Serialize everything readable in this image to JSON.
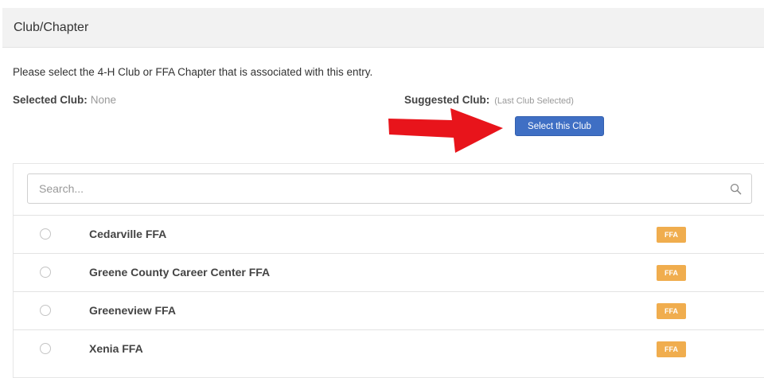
{
  "panel": {
    "title": "Club/Chapter"
  },
  "instructions": "Please select the 4-H Club or FFA Chapter that is associated with this entry.",
  "selected": {
    "label": "Selected Club:",
    "value": "None"
  },
  "suggested": {
    "label": "Suggested Club:",
    "value": "(Last Club Selected)"
  },
  "select_button": {
    "label": "Select this Club"
  },
  "search": {
    "placeholder": "Search...",
    "value": ""
  },
  "clubs": [
    {
      "name": "Cedarville FFA",
      "badge": "FFA"
    },
    {
      "name": "Greene County Career Center FFA",
      "badge": "FFA"
    },
    {
      "name": "Greeneview FFA",
      "badge": "FFA"
    },
    {
      "name": "Xenia FFA",
      "badge": "FFA"
    }
  ],
  "colors": {
    "primary": "#3f6fc4",
    "badge": "#f0ad4e",
    "arrow": "#e8141b",
    "heading_bg": "#f2f2f2"
  },
  "icons": {
    "search": "search-icon",
    "annotation": "red-arrow-icon"
  }
}
